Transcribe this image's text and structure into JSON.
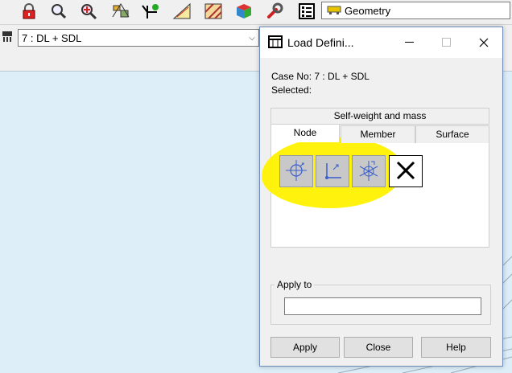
{
  "toolbar": {
    "icons": [
      "lock-icon",
      "magnifier-icon",
      "zoom-target-icon",
      "structure-icon",
      "axes-node-icon",
      "triangle-tool-icon",
      "hatch-tool-icon",
      "cube-icon",
      "wrench-icon",
      "page-list-icon"
    ],
    "geometry_label": "Geometry"
  },
  "loadcase": {
    "value": "7 : DL + SDL"
  },
  "dialog": {
    "title": "Load Defini...",
    "case_no": "Case No: 7 : DL + SDL",
    "selected": "Selected:",
    "tab_self_weight": "Self-weight and mass",
    "tabs": [
      {
        "label": "Node",
        "active": true
      },
      {
        "label": "Member",
        "active": false
      },
      {
        "label": "Surface",
        "active": false
      }
    ],
    "tools": [
      "node-force-icon",
      "node-displacement-icon",
      "node-spring-icon",
      "delete-load-icon"
    ],
    "apply_to_label": "Apply to",
    "apply_to_value": "",
    "buttons": {
      "apply": "Apply",
      "close": "Close",
      "help": "Help"
    }
  },
  "colors": {
    "highlight": "#fff200",
    "canvas": "#ddeef9",
    "dialog_border": "#6f8db8"
  }
}
